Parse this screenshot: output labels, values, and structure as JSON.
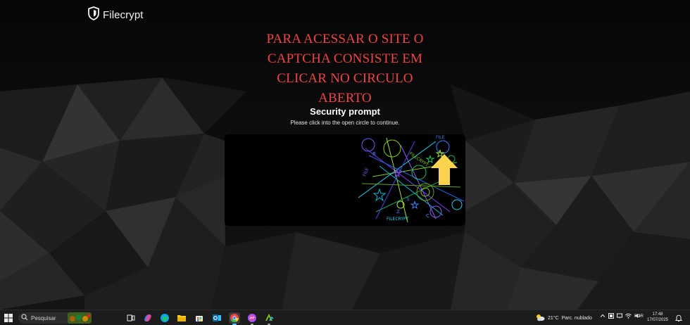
{
  "brand": {
    "name": "Filecrypt",
    "icon": "shield-icon"
  },
  "overlay_message": {
    "lines": [
      "PARA ACESSAR O SITE O",
      "CAPTCHA CONSISTE EM",
      "CLICAR NO CIRCULO",
      "ABERTO"
    ],
    "color": "#ef4444"
  },
  "prompt": {
    "title": "Security prompt",
    "subtitle": "Please click into the open circle to continue."
  },
  "captcha": {
    "icon": "captcha-circles-image",
    "arrow_icon": "arrow-up-icon",
    "arrow_color": "#fcd34d"
  },
  "taskbar": {
    "search_placeholder": "Pesquisar",
    "apps": [
      {
        "name": "task-view-icon",
        "running": false,
        "active": false
      },
      {
        "name": "copilot-icon",
        "running": false,
        "active": false
      },
      {
        "name": "edge-icon",
        "running": false,
        "active": false
      },
      {
        "name": "file-explorer-icon",
        "running": false,
        "active": false
      },
      {
        "name": "store-icon",
        "running": false,
        "active": false
      },
      {
        "name": "outlook-icon",
        "running": false,
        "active": false
      },
      {
        "name": "chrome-icon",
        "running": true,
        "active": true
      },
      {
        "name": "messenger-icon",
        "running": true,
        "active": false
      },
      {
        "name": "app-icon",
        "running": true,
        "active": false
      }
    ],
    "weather": {
      "temperature": "21°C",
      "condition": "Parc. nublado"
    },
    "language": "POR",
    "time": "17:48",
    "date": "17/07/2025"
  }
}
